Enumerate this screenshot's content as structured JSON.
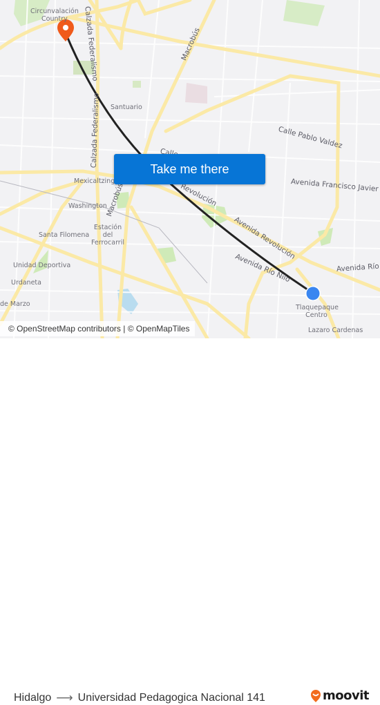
{
  "map": {
    "place_labels": [
      {
        "id": "circunvalacion-country",
        "text": "Circunvalación\nCountry"
      },
      {
        "id": "santuario",
        "text": "Santuario"
      },
      {
        "id": "mexicaltzingo",
        "text": "Mexicaltzingo"
      },
      {
        "id": "washington",
        "text": "Washington"
      },
      {
        "id": "estacion-del-ferrocarril",
        "text": "Estación del Ferrocarril"
      },
      {
        "id": "santa-filomena",
        "text": "Santa Filomena"
      },
      {
        "id": "unidad-deportiva",
        "text": "Unidad Deportiva"
      },
      {
        "id": "urdaneta",
        "text": "Urdaneta"
      },
      {
        "id": "de-marzo",
        "text": "de Marzo"
      },
      {
        "id": "tlaquepaque-centro",
        "text": "Tlaquepaque Centro"
      },
      {
        "id": "lazaro-cardenas",
        "text": "Lazaro Cardenas"
      }
    ],
    "street_labels": {
      "calzada_federalismo_top": "Calzada Federalismo",
      "calzada_federalismo": "Calzada Federalismo",
      "macrobus_top": "Macrobús",
      "macrobus": "Macrobús",
      "calle_pablo_valdez": "Calle Pablo Valdez",
      "avenida_francisco_javier": "Avenida Francisco Javier M",
      "calle_partial": "Calle",
      "revolucion_partial": "Revolución",
      "avenida_revolucion": "Avenida Revolución",
      "avenida_rio_nilo": "Avenida Río Nilo",
      "avenida_rio": "Avenida Río"
    },
    "origin_marker": {
      "label": "Hidalgo",
      "color": "#3a86f0"
    },
    "destination_marker": {
      "label": "Universidad Pedagogica Nacional 141",
      "color": "#f05a1a"
    },
    "route_line_color": "#222222",
    "cta_button": {
      "label": "Take me there",
      "color": "#0775d6"
    },
    "attribution": "© OpenStreetMap contributors | © OpenMapTiles"
  },
  "footer": {
    "origin": "Hidalgo",
    "arrow": "⟶",
    "destination": "Universidad Pedagogica Nacional 141",
    "brand": "moovit",
    "brand_color": "#f26b1d"
  }
}
